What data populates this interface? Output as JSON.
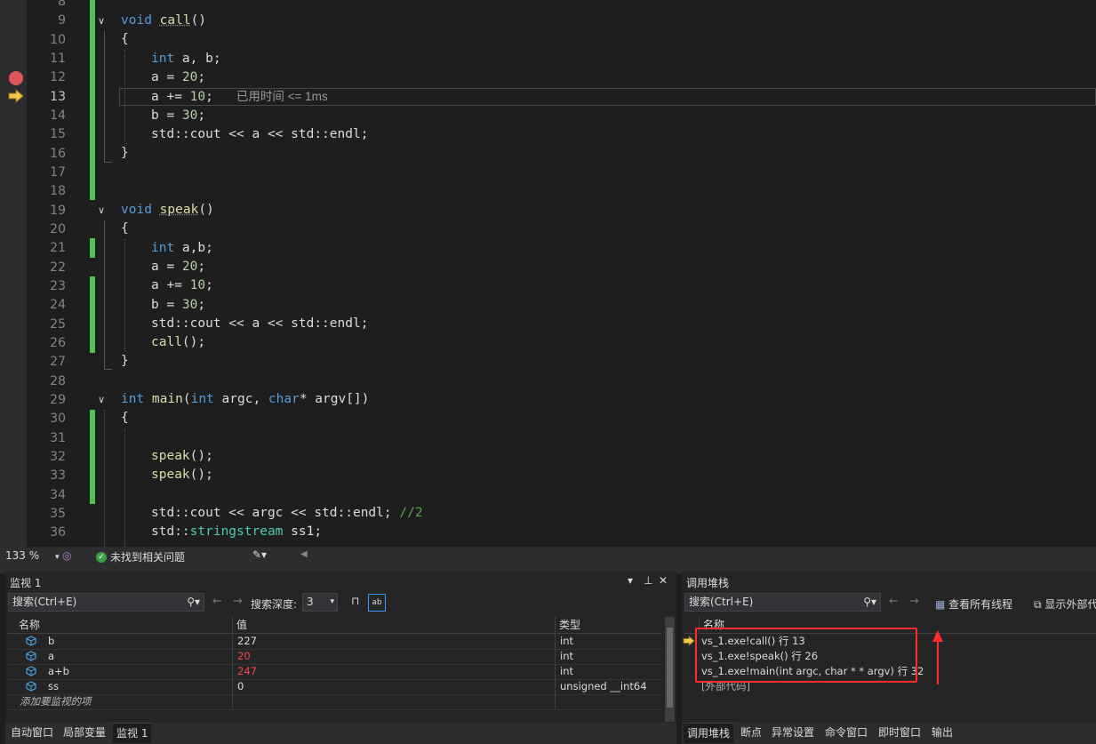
{
  "editor": {
    "lines": [
      {
        "n": "8"
      },
      {
        "n": "9"
      },
      {
        "n": "10"
      },
      {
        "n": "11"
      },
      {
        "n": "12"
      },
      {
        "n": "13"
      },
      {
        "n": "14"
      },
      {
        "n": "15"
      },
      {
        "n": "16"
      },
      {
        "n": "17"
      },
      {
        "n": "18"
      },
      {
        "n": "19"
      },
      {
        "n": "20"
      },
      {
        "n": "21"
      },
      {
        "n": "22"
      },
      {
        "n": "23"
      },
      {
        "n": "24"
      },
      {
        "n": "25"
      },
      {
        "n": "26"
      },
      {
        "n": "27"
      },
      {
        "n": "28"
      },
      {
        "n": "29"
      },
      {
        "n": "30"
      },
      {
        "n": "31"
      },
      {
        "n": "32"
      },
      {
        "n": "33"
      },
      {
        "n": "34"
      },
      {
        "n": "35"
      },
      {
        "n": "36"
      }
    ],
    "code": {
      "l9_kw": "void",
      "l9_fn": "call",
      "l9_rest": "()",
      "l10": "{",
      "l11_kw": "int",
      "l11_rest": " a, b;",
      "l12_a": "a = ",
      "l12_num": "20",
      "l12_end": ";",
      "l13_a": "a += ",
      "l13_num": "10",
      "l13_end": ";",
      "l13_hint": "已用时间 <= 1ms",
      "l14_a": "b = ",
      "l14_num": "30",
      "l14_end": ";",
      "l15": "std::cout << a << std::endl;",
      "l16": "}",
      "l19_kw": "void",
      "l19_fn": "speak",
      "l19_rest": "()",
      "l20": "{",
      "l21_kw": "int",
      "l21_rest": " a,b;",
      "l22_a": "a = ",
      "l22_num": "20",
      "l22_end": ";",
      "l23_a": "a += ",
      "l23_num": "10",
      "l23_end": ";",
      "l24_a": "b = ",
      "l24_num": "30",
      "l24_end": ";",
      "l25": "std::cout << a << std::endl;",
      "l26_fn": "call",
      "l26_rest": "();",
      "l27": "}",
      "l29_kw": "int",
      "l29_fn": " main",
      "l29_p1": "(",
      "l29_kw2": "int",
      "l29_p2": " argc, ",
      "l29_kw3": "char",
      "l29_p3": "* argv[])",
      "l30": "{",
      "l32_fn": "speak",
      "l32_rest": "();",
      "l33_fn": "speak",
      "l33_rest": "();",
      "l35_a": "std::cout << argc << std::endl; ",
      "l35_cm": "//2",
      "l36_a": "std::",
      "l36_ty": "stringstream",
      "l36_b": " ss1;"
    }
  },
  "status": {
    "zoom": "133 %",
    "issues": "未找到相关问题"
  },
  "watch": {
    "title": "监视 1",
    "search_placeholder": "搜索(Ctrl+E)",
    "depth_label": "搜索深度:",
    "depth_value": "3",
    "columns": [
      "名称",
      "值",
      "类型"
    ],
    "rows": [
      {
        "name": "b",
        "value": "227",
        "type": "int",
        "changed": false
      },
      {
        "name": "a",
        "value": "20",
        "type": "int",
        "changed": true
      },
      {
        "name": "a+b",
        "value": "247",
        "type": "int",
        "changed": true
      },
      {
        "name": "ss",
        "value": "0",
        "type": "unsigned __int64",
        "changed": false
      }
    ],
    "add_item": "添加要监视的项",
    "tabs": [
      "自动窗口",
      "局部变量",
      "监视 1"
    ]
  },
  "callstack": {
    "title": "调用堆栈",
    "search_placeholder": "搜索(Ctrl+E)",
    "view_threads": "查看所有线程",
    "show_external": "显示外部代",
    "column": "名称",
    "frames": [
      "vs_1.exe!call() 行 13",
      "vs_1.exe!speak() 行 26",
      "vs_1.exe!main(int argc, char * * argv) 行 32",
      "[外部代码]"
    ],
    "tabs": [
      "调用堆栈",
      "断点",
      "异常设置",
      "命令窗口",
      "即时窗口",
      "输出"
    ]
  },
  "colors": {
    "breakpoint": "#e0555c",
    "annotation": "#ff2a2a",
    "change_bar": "#4ec04e",
    "changed_value": "#f44747"
  }
}
